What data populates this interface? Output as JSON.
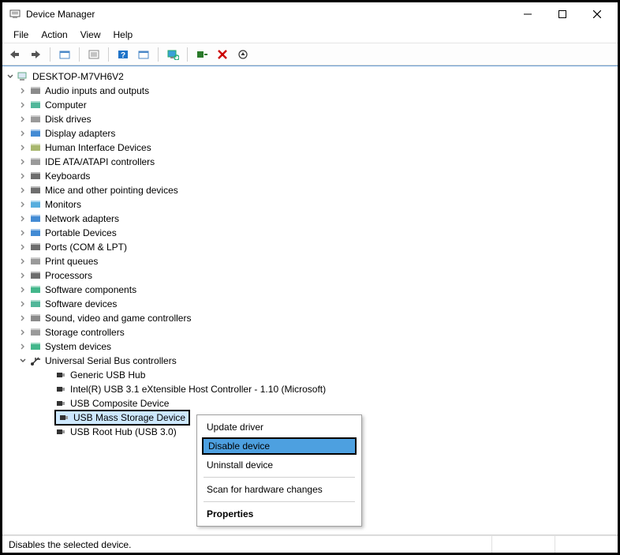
{
  "window": {
    "title": "Device Manager"
  },
  "menubar": {
    "items": [
      "File",
      "Action",
      "View",
      "Help"
    ]
  },
  "toolbar": {
    "icons": [
      "back-arrow",
      "forward-arrow",
      "show-hidden",
      "properties",
      "help",
      "update",
      "scan-monitor",
      "add-legacy",
      "delete-x",
      "uninstall"
    ]
  },
  "tree": {
    "root": {
      "label": "DESKTOP-M7VH6V2"
    },
    "categories": [
      {
        "label": "Audio inputs and outputs"
      },
      {
        "label": "Computer"
      },
      {
        "label": "Disk drives"
      },
      {
        "label": "Display adapters"
      },
      {
        "label": "Human Interface Devices"
      },
      {
        "label": "IDE ATA/ATAPI controllers"
      },
      {
        "label": "Keyboards"
      },
      {
        "label": "Mice and other pointing devices"
      },
      {
        "label": "Monitors"
      },
      {
        "label": "Network adapters"
      },
      {
        "label": "Portable Devices"
      },
      {
        "label": "Ports (COM & LPT)"
      },
      {
        "label": "Print queues"
      },
      {
        "label": "Processors"
      },
      {
        "label": "Software components"
      },
      {
        "label": "Software devices"
      },
      {
        "label": "Sound, video and game controllers"
      },
      {
        "label": "Storage controllers"
      },
      {
        "label": "System devices"
      }
    ],
    "usb": {
      "label": "Universal Serial Bus controllers",
      "children": [
        {
          "label": "Generic USB Hub"
        },
        {
          "label": "Intel(R) USB 3.1 eXtensible Host Controller - 1.10 (Microsoft)"
        },
        {
          "label": "USB Composite Device"
        },
        {
          "label": "USB Mass Storage Device",
          "selected": true
        },
        {
          "label": "USB Root Hub (USB 3.0)"
        }
      ]
    }
  },
  "context_menu": {
    "items": [
      {
        "label": "Update driver"
      },
      {
        "label": "Disable device",
        "highlight": true
      },
      {
        "label": "Uninstall device"
      },
      {
        "separator": true
      },
      {
        "label": "Scan for hardware changes"
      },
      {
        "separator": true
      },
      {
        "label": "Properties",
        "bold": true
      }
    ]
  },
  "statusbar": {
    "text": "Disables the selected device."
  }
}
